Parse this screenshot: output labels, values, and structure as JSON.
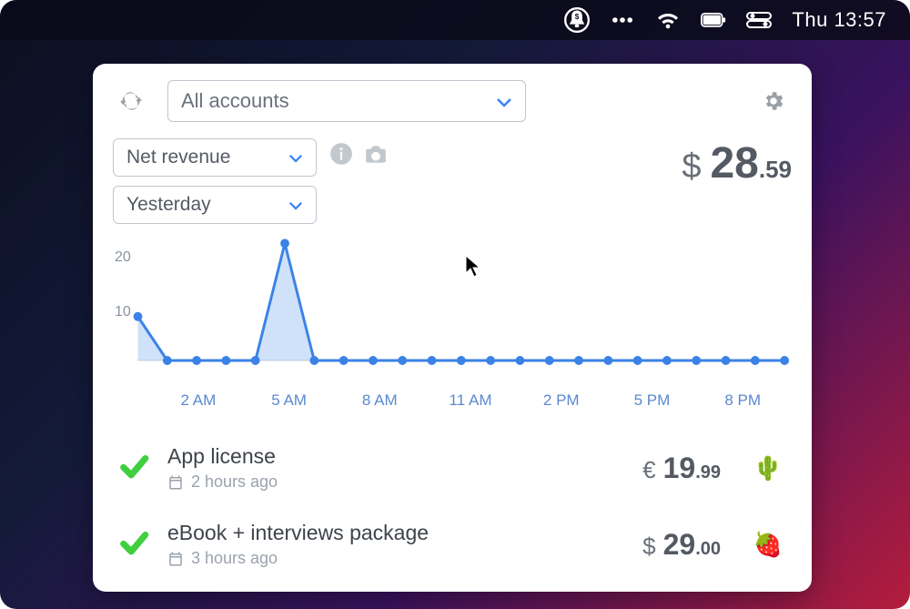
{
  "menubar": {
    "clock": "Thu 13:57"
  },
  "panel": {
    "account_selector": {
      "label": "All accounts"
    },
    "metric_selector": {
      "label": "Net revenue"
    },
    "period_selector": {
      "label": "Yesterday"
    },
    "total": {
      "currency": "$",
      "whole": "28",
      "cents": ".59"
    }
  },
  "chart_data": {
    "type": "line",
    "title": "",
    "xlabel": "",
    "ylabel": "",
    "ylim": [
      0,
      25
    ],
    "y_ticks": [
      "20",
      "10"
    ],
    "categories": [
      "12 AM",
      "1 AM",
      "2 AM",
      "3 AM",
      "4 AM",
      "5 AM",
      "6 AM",
      "7 AM",
      "8 AM",
      "9 AM",
      "10 AM",
      "11 AM",
      "12 PM",
      "1 PM",
      "2 PM",
      "3 PM",
      "4 PM",
      "5 PM",
      "6 PM",
      "7 PM",
      "8 PM",
      "9 PM",
      "10 PM"
    ],
    "x_tick_labels_shown": [
      "2 AM",
      "5 AM",
      "8 AM",
      "11 AM",
      "2 PM",
      "5 PM",
      "8 PM"
    ],
    "values": [
      9,
      0,
      0,
      0,
      0,
      24,
      0,
      0,
      0,
      0,
      0,
      0,
      0,
      0,
      0,
      0,
      0,
      0,
      0,
      0,
      0,
      0,
      0
    ]
  },
  "transactions": [
    {
      "status": "ok",
      "title": "App license",
      "time_ago": "2 hours ago",
      "currency": "€",
      "whole": "19",
      "cents": ".99",
      "emoji": "🌵"
    },
    {
      "status": "ok",
      "title": "eBook + interviews package",
      "time_ago": "3 hours ago",
      "currency": "$",
      "whole": "29",
      "cents": ".00",
      "emoji": "🍓"
    }
  ]
}
